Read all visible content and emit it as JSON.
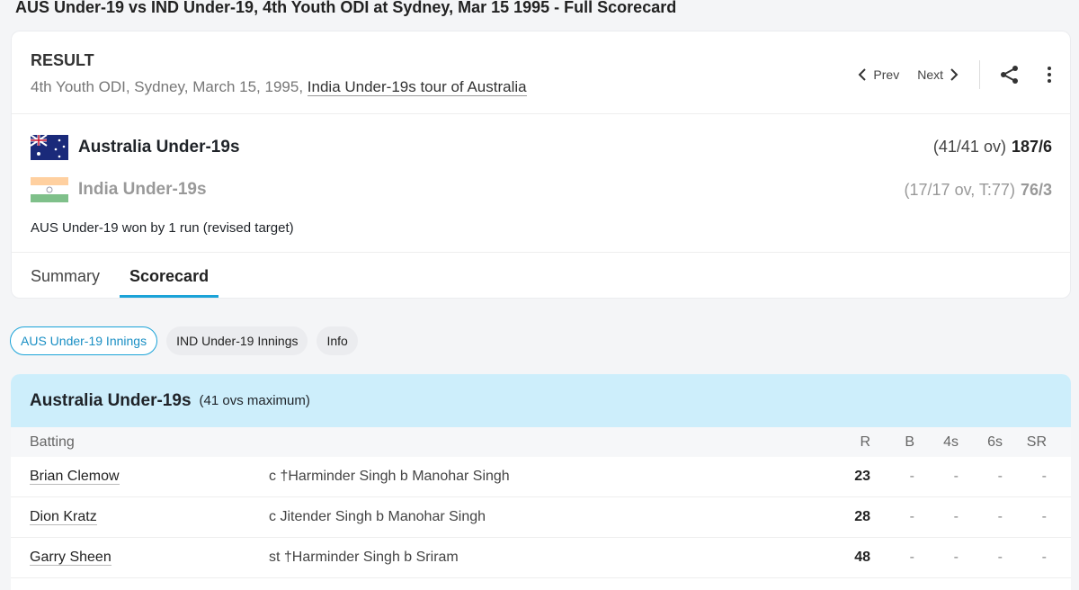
{
  "page_title": "AUS Under-19 vs IND Under-19, 4th Youth ODI at Sydney, Mar 15 1995 - Full Scorecard",
  "header": {
    "status": "RESULT",
    "details": "4th Youth ODI, Sydney, March 15, 1995,",
    "series_link": "India Under-19s tour of Australia",
    "prev": "Prev",
    "next": "Next"
  },
  "teams": [
    {
      "name": "Australia Under-19s",
      "overs": "(41/41 ov)",
      "score": "187/6",
      "flag": "australia-flag"
    },
    {
      "name": "India Under-19s",
      "overs": "(17/17 ov, T:77)",
      "score": "76/3",
      "flag": "india-flag"
    }
  ],
  "result": "AUS Under-19 won by 1 run (revised target)",
  "tabs": [
    "Summary",
    "Scorecard"
  ],
  "active_tab": "Scorecard",
  "innings_pills": [
    "AUS Under-19 Innings",
    "IND Under-19 Innings",
    "Info"
  ],
  "innings": {
    "team": "Australia Under-19s",
    "note": "(41 ovs maximum)",
    "columns": [
      "Batting",
      "R",
      "B",
      "4s",
      "6s",
      "SR"
    ],
    "rows": [
      {
        "batter": "Brian Clemow",
        "dismissal": "c †Harminder Singh b Manohar Singh",
        "R": "23",
        "B": "-",
        "4s": "-",
        "6s": "-",
        "SR": "-"
      },
      {
        "batter": "Dion Kratz",
        "dismissal": "c Jitender Singh b Manohar Singh",
        "R": "28",
        "B": "-",
        "4s": "-",
        "6s": "-",
        "SR": "-"
      },
      {
        "batter": "Garry Sheen",
        "dismissal": "st †Harminder Singh b Sriram",
        "R": "48",
        "B": "-",
        "4s": "-",
        "6s": "-",
        "SR": "-"
      }
    ]
  },
  "colors": {
    "accent": "#1ba3d8",
    "innings_header": "#cdeefb"
  }
}
